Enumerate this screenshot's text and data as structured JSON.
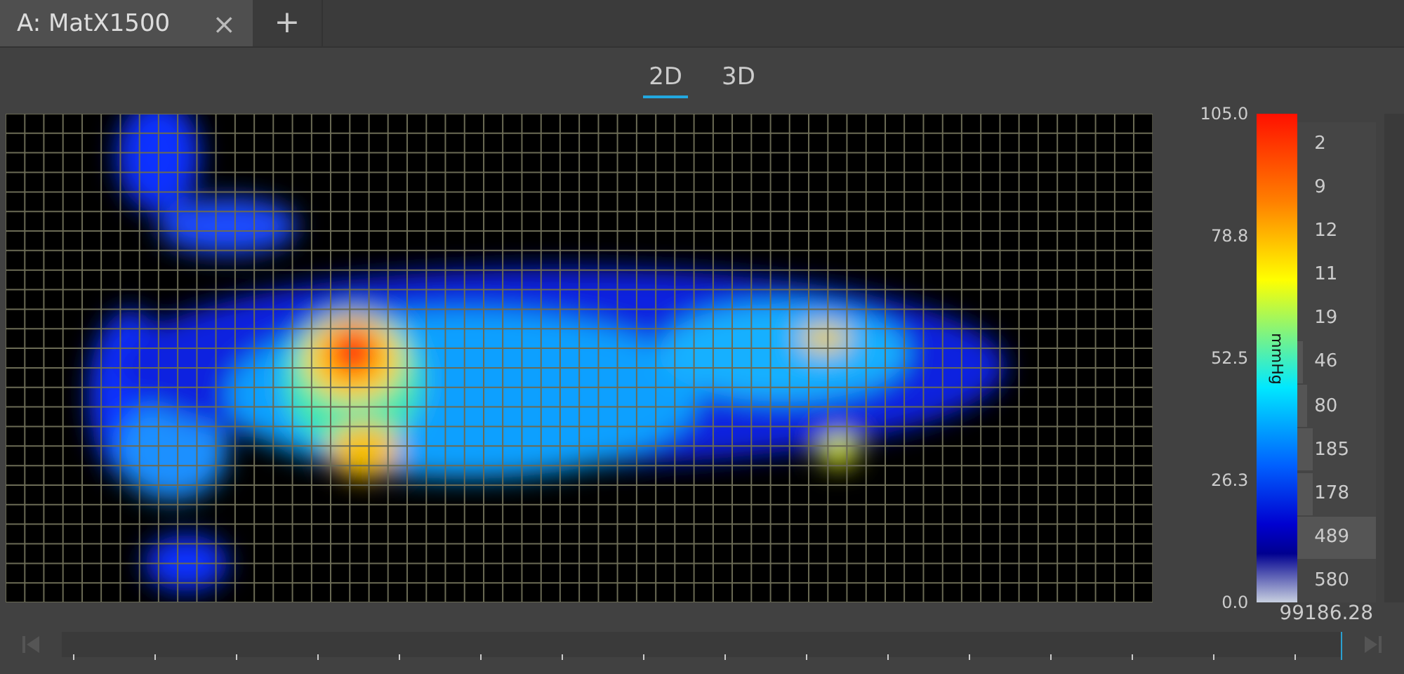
{
  "tabs": [
    {
      "label": "A: MatX1500",
      "selected": true,
      "close": "×"
    }
  ],
  "add_tab": "+",
  "view_modes": [
    {
      "label": "2D",
      "selected": true
    },
    {
      "label": "3D",
      "selected": false
    }
  ],
  "colorbar": {
    "unit": "mmHg",
    "ticks": [
      "105.0",
      "78.8",
      "52.5",
      "26.3",
      "0.0"
    ]
  },
  "histogram": [
    {
      "count": "2"
    },
    {
      "count": "9"
    },
    {
      "count": "12"
    },
    {
      "count": "11"
    },
    {
      "count": "19"
    },
    {
      "count": "46"
    },
    {
      "count": "80"
    },
    {
      "count": "185"
    },
    {
      "count": "178"
    },
    {
      "count": "489"
    },
    {
      "count": "580"
    }
  ],
  "total": "99186.28",
  "timeline": {
    "level": 1
  }
}
